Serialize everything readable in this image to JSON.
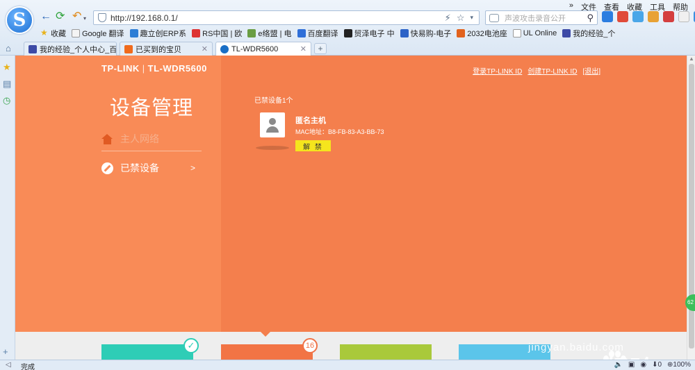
{
  "browser": {
    "menu": [
      "»",
      "文件",
      "查看",
      "收藏",
      "工具",
      "帮助"
    ],
    "url": "http://192.168.0.1/",
    "search_placeholder": "声波攻击录音公开",
    "bookmarks": [
      "收藏",
      "Google 翻译",
      "趣立创ERP系",
      "RS中国 | 欧",
      "e络盟 | 电",
      "百度翻译",
      "贸泽电子 中",
      "快易购-电子",
      "2032电池座",
      "UL Online",
      "我的经验_个"
    ],
    "tabs": [
      "我的经验_个人中心_百度",
      "已买到的宝贝",
      "TL-WDR5600"
    ],
    "status_text": "完成",
    "zoom": "100%",
    "download_count": "0",
    "side_badge": "62"
  },
  "router": {
    "brand": "TP-LINK",
    "model": "TL-WDR5600",
    "page_title": "设备管理",
    "nav_host_network": "主人网络",
    "nav_blocked": "已禁设备",
    "nav_arrow": ">",
    "links": [
      "登录TP-LINK ID",
      "创建TP-LINK ID",
      "[退出]"
    ],
    "blocked_count_label": "已禁设备1个",
    "device_name": "匿名主机",
    "device_mac": "MAC地址：B8-FB-83-A3-BB-73",
    "unblock_label": "解 禁",
    "badge_count": "16",
    "card_colors": [
      "#2ecdb6",
      "#f27445",
      "#a9c93b",
      "#5bc5ea"
    ]
  },
  "watermark": {
    "text": "Bai  du经验",
    "url": "jingyan.baidu.com"
  }
}
